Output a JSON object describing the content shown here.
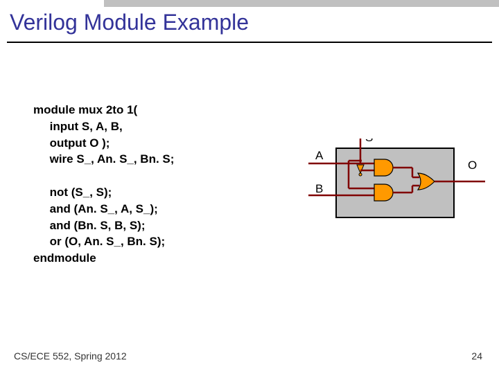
{
  "title": "Verilog Module Example",
  "code": "module mux 2to 1(\n     input S, A, B,\n     output O );\n     wire S_, An. S_, Bn. S;\n\n     not (S_, S);\n     and (An. S_, A, S_);\n     and (Bn. S, B, S);\n     or (O, An. S_, Bn. S);\nendmodule",
  "labels": {
    "S": "S",
    "A": "A",
    "B": "B",
    "O": "O"
  },
  "footer": "CS/ECE 552, Spring 2012",
  "page": "24",
  "chart_data": {
    "type": "diagram",
    "description": "2-to-1 multiplexer gate-level schematic",
    "inputs": [
      "S",
      "A",
      "B"
    ],
    "outputs": [
      "O"
    ],
    "gates": [
      {
        "type": "not",
        "id": "not1",
        "inputs": [
          "S"
        ],
        "output": "S_"
      },
      {
        "type": "and",
        "id": "and1",
        "inputs": [
          "A",
          "S_"
        ],
        "output": "AnS_"
      },
      {
        "type": "and",
        "id": "and2",
        "inputs": [
          "B",
          "S"
        ],
        "output": "BnS"
      },
      {
        "type": "or",
        "id": "or1",
        "inputs": [
          "AnS_",
          "BnS"
        ],
        "output": "O"
      }
    ]
  }
}
